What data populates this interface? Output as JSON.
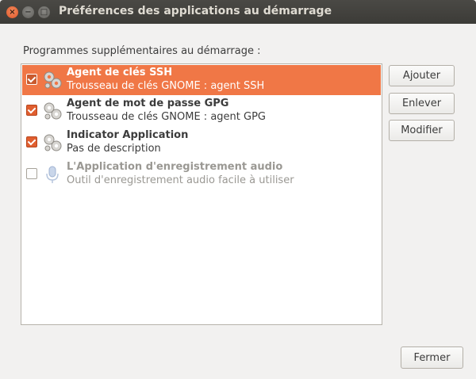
{
  "window": {
    "title": "Préférences des applications au démarrage",
    "close_glyph": "×",
    "minimize_glyph": "−",
    "maximize_glyph": "□"
  },
  "section_label": "Programmes supplémentaires au démarrage :",
  "apps": [
    {
      "name": "Agent de clés SSH",
      "description": "Trousseau de clés GNOME : agent SSH",
      "checked": true,
      "selected": true,
      "enabled": true,
      "icon": "gears-icon"
    },
    {
      "name": "Agent de mot de passe GPG",
      "description": "Trousseau de clés GNOME : agent GPG",
      "checked": true,
      "selected": false,
      "enabled": true,
      "icon": "gears-icon"
    },
    {
      "name": "Indicator Application",
      "description": "Pas de description",
      "checked": true,
      "selected": false,
      "enabled": true,
      "icon": "gears-icon"
    },
    {
      "name": "L'Application d'enregistrement audio",
      "description": "Outil d'enregistrement audio facile à utiliser",
      "checked": false,
      "selected": false,
      "enabled": false,
      "icon": "microphone-icon"
    }
  ],
  "buttons": {
    "add": "Ajouter",
    "remove": "Enlever",
    "edit": "Modifier",
    "close": "Fermer"
  },
  "colors": {
    "accent": "#f07746",
    "titlebar": "#3c3b37",
    "close_button": "#e0562a"
  }
}
